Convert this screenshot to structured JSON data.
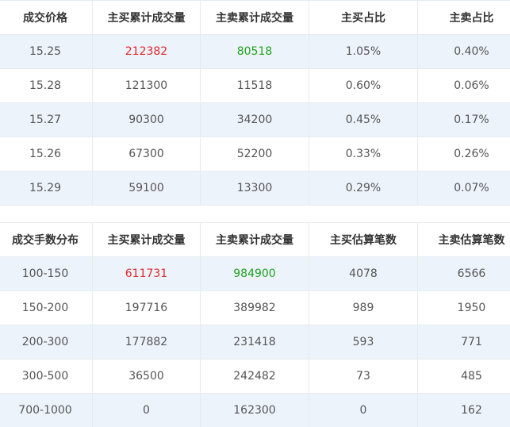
{
  "price_table": {
    "headers": [
      "成交价格",
      "主买累计成交量",
      "主卖累计成交量",
      "主买占比",
      "主卖占比"
    ],
    "rows": [
      [
        "15.25",
        "212382",
        "80518",
        "1.05%",
        "0.40%"
      ],
      [
        "15.28",
        "121300",
        "11518",
        "0.60%",
        "0.06%"
      ],
      [
        "15.27",
        "90300",
        "34200",
        "0.45%",
        "0.17%"
      ],
      [
        "15.26",
        "67300",
        "52200",
        "0.33%",
        "0.26%"
      ],
      [
        "15.29",
        "59100",
        "13300",
        "0.29%",
        "0.07%"
      ]
    ]
  },
  "lot_table": {
    "headers": [
      "成交手数分布",
      "主买累计成交量",
      "主卖累计成交量",
      "主买估算笔数",
      "主卖估算笔数"
    ],
    "rows": [
      [
        "100-150",
        "611731",
        "984900",
        "4078",
        "6566"
      ],
      [
        "150-200",
        "197716",
        "389982",
        "989",
        "1950"
      ],
      [
        "200-300",
        "177882",
        "231418",
        "593",
        "771"
      ],
      [
        "300-500",
        "36500",
        "242482",
        "73",
        "485"
      ],
      [
        "700-1000",
        "0",
        "162300",
        "0",
        "162"
      ]
    ]
  },
  "colors": {
    "buy_highlight": "#e0282c",
    "sell_highlight": "#1ea11e",
    "row_stripe": "#edf3fb",
    "border": "#e6ebf1"
  }
}
